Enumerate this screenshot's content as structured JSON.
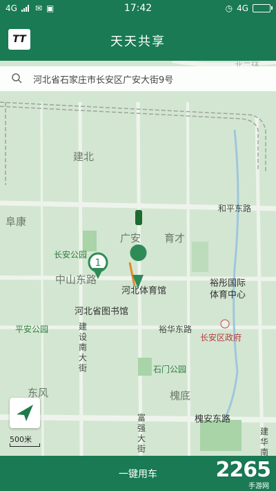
{
  "status_bar": {
    "left_network": "4G",
    "time": "17:42",
    "right_network": "4G"
  },
  "header": {
    "logo_text": "TT",
    "title": "天天共享"
  },
  "search": {
    "address": "河北省石家庄市长安区广安大街9号"
  },
  "map": {
    "labels": {
      "north_ring": "北二环",
      "jianbei": "建北",
      "hepingdong": "和平东路",
      "fukang": "阜康",
      "guangan": "广安",
      "yucai": "育才",
      "changan_park": "长安公园",
      "zhongshandong": "中山东路",
      "sports_hall": "河北体育馆",
      "yutong": "裕彤国际\n体育中心",
      "library": "河北省图书馆",
      "yuhuadong": "裕华东路",
      "changan_gov": "长安区政府",
      "pingan_park": "平安公园",
      "jianshe_nan": "建设南大街",
      "shimen_park": "石门公园",
      "dongfeng": "东风",
      "huaidi": "槐底",
      "fuqiang": "富强大街",
      "huaiandong": "槐安东路",
      "jianhua": "建华南大"
    },
    "cluster_count": "1",
    "scale_label": "500米"
  },
  "bottom": {
    "cta_label": "一键用车",
    "watermark": "2265",
    "watermark_sub": "手游网"
  },
  "colors": {
    "brand": "#197a54",
    "map_bg": "#d3e6d2",
    "road": "#eef4ec"
  }
}
